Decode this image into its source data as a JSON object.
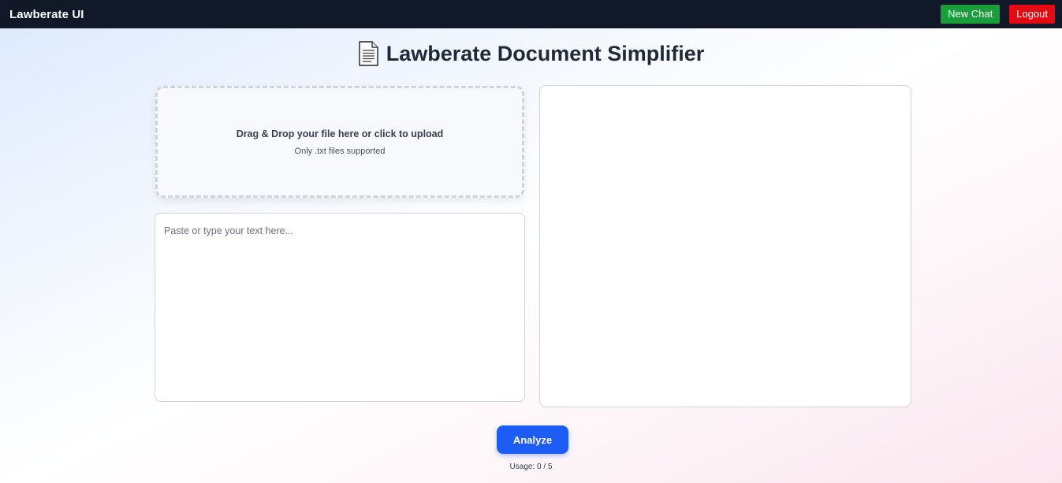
{
  "navbar": {
    "brand": "Lawberate UI",
    "new_chat_label": "New Chat",
    "logout_label": "Logout"
  },
  "page": {
    "title": "Lawberate Document Simplifier"
  },
  "upload": {
    "main_text": "Drag & Drop your file here or click to upload",
    "sub_text": "Only .txt files supported"
  },
  "text_input": {
    "value": "",
    "placeholder": "Paste or type your text here..."
  },
  "output": {
    "text": ""
  },
  "actions": {
    "analyze_label": "Analyze"
  },
  "usage": {
    "text": "Usage: 0 / 5"
  },
  "colors": {
    "navbar_bg": "#111827",
    "new_chat": "#1a9e3c",
    "logout": "#e50914",
    "analyze": "#1d5cf5"
  },
  "icons": {
    "title_icon": "document-icon"
  }
}
